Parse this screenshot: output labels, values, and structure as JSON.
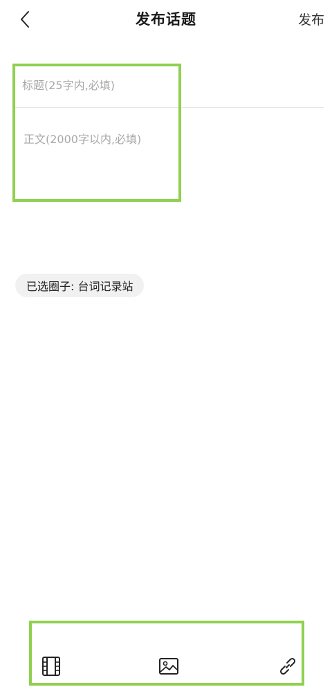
{
  "header": {
    "title": "发布话题",
    "publish_label": "发布",
    "back_icon": "chevron-left-icon"
  },
  "form": {
    "title_placeholder": "标题(25字内,必填)",
    "title_value": "",
    "body_placeholder": "正文(2000字以内,必填)",
    "body_value": ""
  },
  "circle": {
    "label": "已选圈子:  台词记录站"
  },
  "toolbar": {
    "icons": [
      "video-icon",
      "image-icon",
      "link-icon"
    ]
  },
  "colors": {
    "highlight": "#8fd14f",
    "chip_bg": "#f1f1f1",
    "placeholder": "#a8a8a8",
    "divider": "#e6e6e6"
  }
}
